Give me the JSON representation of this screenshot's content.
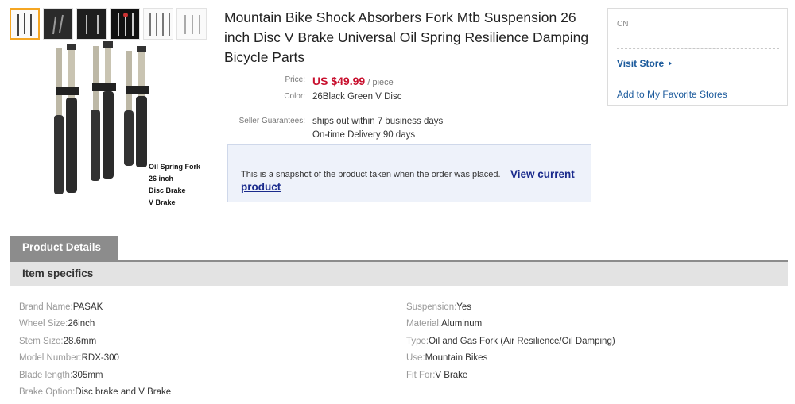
{
  "product": {
    "title": "Mountain Bike Shock Absorbers Fork Mtb Suspension 26 inch Disc V Brake Universal Oil Spring Resilience Damping Bicycle Parts",
    "image_caption": [
      "Oil Spring Fork",
      "26 inch",
      "Disc Brake",
      "V Brake"
    ],
    "price_label": "Price:",
    "price": "US $49.99",
    "price_unit": "/ piece",
    "color_label": "Color:",
    "color": "26Black Green V Disc",
    "guarantee_label": "Seller Guarantees:",
    "guarantees": [
      "ships out within 7 business days",
      "On-time Delivery 90 days"
    ]
  },
  "snapshot": {
    "text": "This is a snapshot of the product taken when the order was placed.",
    "link": "View current product"
  },
  "store": {
    "country": "CN",
    "visit_label": "Visit Store",
    "favorite_label": "Add to My Favorite Stores"
  },
  "details": {
    "tab_label": "Product Details",
    "section_title": "Item specifics",
    "left": [
      {
        "key": "Brand Name:",
        "value": "PASAK"
      },
      {
        "key": "Wheel Size:",
        "value": "26inch"
      },
      {
        "key": "Stem Size:",
        "value": "28.6mm"
      },
      {
        "key": "Model Number:",
        "value": "RDX-300"
      },
      {
        "key": "Blade length:",
        "value": "305mm"
      },
      {
        "key": "Brake Option:",
        "value": "Disc brake and V Brake"
      }
    ],
    "right": [
      {
        "key": "Suspension:",
        "value": "Yes"
      },
      {
        "key": "Material:",
        "value": "Aluminum"
      },
      {
        "key": "Type:",
        "value": "Oil and Gas Fork (Air Resilience/Oil Damping)"
      },
      {
        "key": "Use:",
        "value": "Mountain Bikes"
      },
      {
        "key": "Fit For:",
        "value": "V Brake"
      }
    ]
  },
  "colors": {
    "price": "#c8102e",
    "link": "#1b5a9c",
    "tab": "#8c8c8c"
  }
}
